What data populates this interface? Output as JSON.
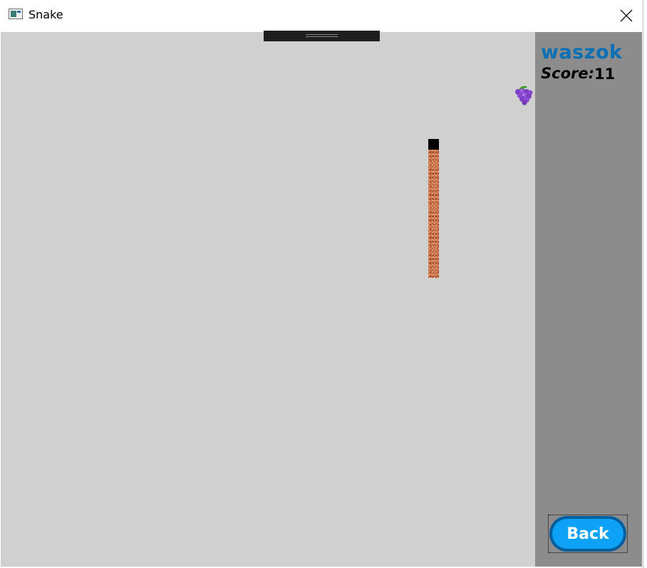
{
  "window": {
    "title": "Snake",
    "close_icon": "close-icon"
  },
  "game": {
    "background_color": "#d0d0d0",
    "snake": {
      "head_color": "#000000",
      "body_texture": "orange-brown-brick",
      "length_segments": 13
    },
    "fruit": {
      "icon": "grapes-icon",
      "color": "#8c3fd1"
    }
  },
  "sidebar": {
    "background_color": "#8c8c8c",
    "player_name": "waszok",
    "player_name_color": "#0a6fb5",
    "score_label": "Score:",
    "score_value": "11",
    "back_label": "Back",
    "back_color": "#0ea2f7"
  }
}
